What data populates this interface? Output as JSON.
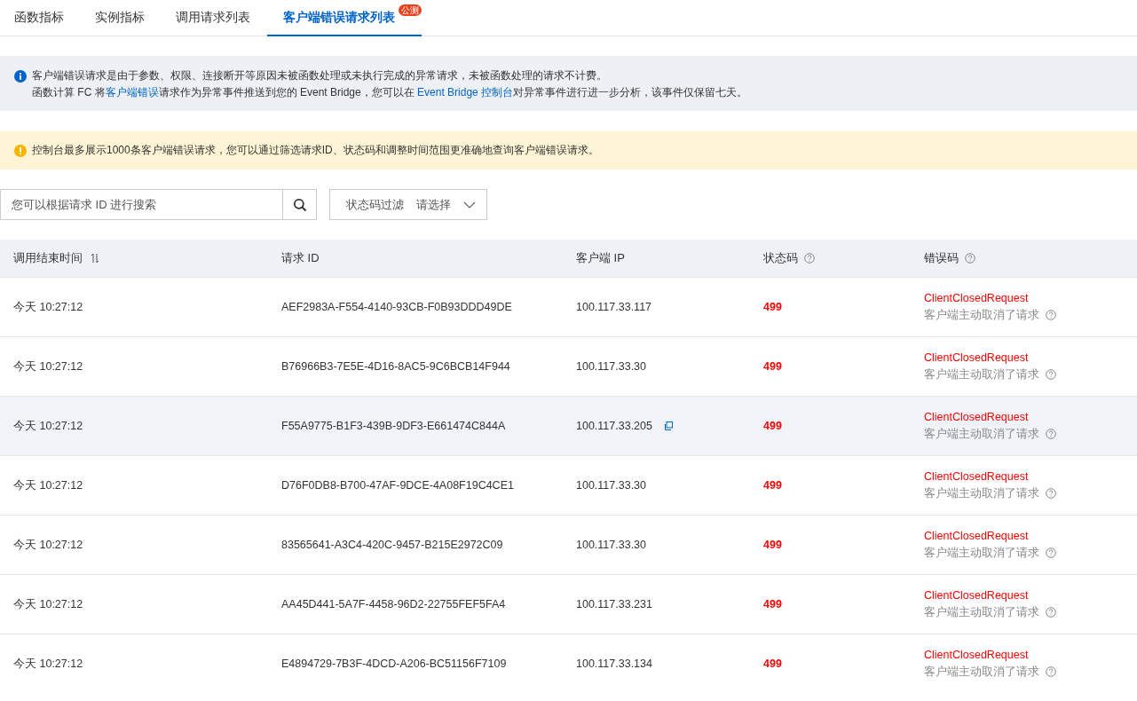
{
  "tabs": [
    {
      "label": "函数指标",
      "selected": false
    },
    {
      "label": "实例指标",
      "selected": false
    },
    {
      "label": "调用请求列表",
      "selected": false
    },
    {
      "label": "客户端错误请求列表",
      "selected": true,
      "badge": "公测"
    }
  ],
  "info": {
    "lines": [
      {
        "segments": [
          {
            "text": "客户端错误请求是由于参数、权限、连接断开等原因未被函数处理或未执行完成的异常请求，未被函数处理的请求不计费。",
            "link": false
          }
        ]
      },
      {
        "segments": [
          {
            "text": "函数计算 FC 将",
            "link": false
          },
          {
            "text": "客户端错误",
            "link": true
          },
          {
            "text": "请求作为异常事件推送到您的 Event Bridge，您可以在 ",
            "link": false
          },
          {
            "text": "Event Bridge 控制台",
            "link": true
          },
          {
            "text": "对异常事件进行进一步分析，该事件仅保留七天。",
            "link": false
          }
        ]
      }
    ]
  },
  "warning": {
    "text": "控制台最多展示1000条客户端错误请求，您可以通过筛选请求ID、状态码和调整时间范围更准确地查询客户端错误请求。"
  },
  "search": {
    "placeholder": "您可以根据请求 ID 进行搜索"
  },
  "filter": {
    "label": "状态码过滤",
    "placeholder": "请选择"
  },
  "table": {
    "columns": [
      {
        "label": "调用结束时间",
        "sortable": true,
        "help": false
      },
      {
        "label": "请求 ID",
        "sortable": false,
        "help": false
      },
      {
        "label": "客户端 IP",
        "sortable": false,
        "help": false
      },
      {
        "label": "状态码",
        "sortable": false,
        "help": true
      },
      {
        "label": "错误码",
        "sortable": false,
        "help": true
      }
    ],
    "rows": [
      {
        "time": "今天 10:27:12",
        "request_id": "AEF2983A-F554-4140-93CB-F0B93DDD49DE",
        "client_ip": "100.117.33.117",
        "status": "499",
        "error_code": "ClientClosedRequest",
        "error_desc": "客户端主动取消了请求",
        "hovered": false
      },
      {
        "time": "今天 10:27:12",
        "request_id": "B76966B3-7E5E-4D16-8AC5-9C6BCB14F944",
        "client_ip": "100.117.33.30",
        "status": "499",
        "error_code": "ClientClosedRequest",
        "error_desc": "客户端主动取消了请求",
        "hovered": false
      },
      {
        "time": "今天 10:27:12",
        "request_id": "F55A9775-B1F3-439B-9DF3-E661474C844A",
        "client_ip": "100.117.33.205",
        "status": "499",
        "error_code": "ClientClosedRequest",
        "error_desc": "客户端主动取消了请求",
        "hovered": true
      },
      {
        "time": "今天 10:27:12",
        "request_id": "D76F0DB8-B700-47AF-9DCE-4A08F19C4CE1",
        "client_ip": "100.117.33.30",
        "status": "499",
        "error_code": "ClientClosedRequest",
        "error_desc": "客户端主动取消了请求",
        "hovered": false
      },
      {
        "time": "今天 10:27:12",
        "request_id": "83565641-A3C4-420C-9457-B215E2972C09",
        "client_ip": "100.117.33.30",
        "status": "499",
        "error_code": "ClientClosedRequest",
        "error_desc": "客户端主动取消了请求",
        "hovered": false
      },
      {
        "time": "今天 10:27:12",
        "request_id": "AA45D441-5A7F-4458-96D2-22755FEF5FA4",
        "client_ip": "100.117.33.231",
        "status": "499",
        "error_code": "ClientClosedRequest",
        "error_desc": "客户端主动取消了请求",
        "hovered": false
      },
      {
        "time": "今天 10:27:12",
        "request_id": "E4894729-7B3F-4DCD-A206-BC51156F7109",
        "client_ip": "100.117.33.134",
        "status": "499",
        "error_code": "ClientClosedRequest",
        "error_desc": "客户端主动取消了请求",
        "hovered": false
      }
    ]
  }
}
